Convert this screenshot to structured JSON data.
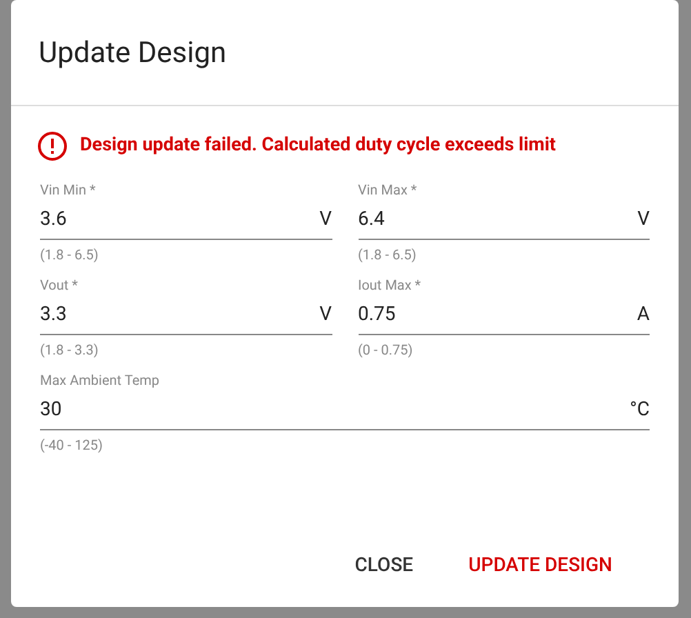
{
  "dialog": {
    "title": "Update Design",
    "error": "Design update failed. Calculated duty cycle exceeds limit",
    "fields": [
      {
        "label": "Vin Min *",
        "value": "3.6",
        "unit": "V",
        "hint": "(1.8 - 6.5)",
        "kind": "half"
      },
      {
        "label": "Vin Max *",
        "value": "6.4",
        "unit": "V",
        "hint": "(1.8 - 6.5)",
        "kind": "half"
      },
      {
        "label": "Vout *",
        "value": "3.3",
        "unit": "V",
        "hint": "(1.8 - 3.3)",
        "kind": "half"
      },
      {
        "label": "Iout Max *",
        "value": "0.75",
        "unit": "A",
        "hint": "(0 - 0.75)",
        "kind": "half"
      },
      {
        "label": "Max Ambient Temp",
        "value": "30",
        "unit": "°C",
        "hint": "(-40 - 125)",
        "kind": "full"
      }
    ],
    "buttons": [
      {
        "label": "CLOSE",
        "kind": "plain"
      },
      {
        "label": "UPDATE DESIGN",
        "kind": "primary"
      }
    ]
  }
}
